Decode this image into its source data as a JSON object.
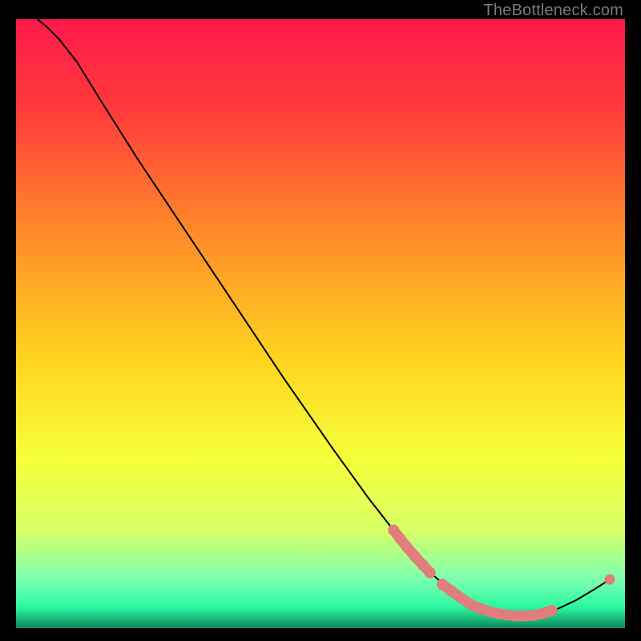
{
  "watermark": "TheBottleneck.com",
  "chart_data": {
    "type": "line",
    "title": "",
    "xlabel": "",
    "ylabel": "",
    "xlim": [
      0,
      100
    ],
    "ylim": [
      0,
      100
    ],
    "background_gradient": {
      "stops": [
        {
          "pos": 0.0,
          "color": "#ff1a4b"
        },
        {
          "pos": 0.15,
          "color": "#ff3b3b"
        },
        {
          "pos": 0.35,
          "color": "#ff8a2a"
        },
        {
          "pos": 0.55,
          "color": "#ffd21f"
        },
        {
          "pos": 0.72,
          "color": "#f6ff3a"
        },
        {
          "pos": 0.84,
          "color": "#d6ff66"
        },
        {
          "pos": 0.92,
          "color": "#7dffb0"
        },
        {
          "pos": 0.965,
          "color": "#2cf8a0"
        },
        {
          "pos": 1.0,
          "color": "#0c8a5a"
        }
      ]
    },
    "curve": [
      {
        "x": 3.5,
        "y": 100.0
      },
      {
        "x": 5.0,
        "y": 98.8
      },
      {
        "x": 7.0,
        "y": 96.8
      },
      {
        "x": 10.0,
        "y": 93.0
      },
      {
        "x": 14.0,
        "y": 86.5
      },
      {
        "x": 20.0,
        "y": 77.0
      },
      {
        "x": 28.0,
        "y": 65.0
      },
      {
        "x": 36.0,
        "y": 53.0
      },
      {
        "x": 44.0,
        "y": 41.0
      },
      {
        "x": 52.0,
        "y": 29.5
      },
      {
        "x": 58.0,
        "y": 21.2
      },
      {
        "x": 63.0,
        "y": 14.8
      },
      {
        "x": 67.5,
        "y": 9.6
      },
      {
        "x": 71.0,
        "y": 6.5
      },
      {
        "x": 74.0,
        "y": 4.3
      },
      {
        "x": 77.0,
        "y": 2.9
      },
      {
        "x": 80.0,
        "y": 2.2
      },
      {
        "x": 83.0,
        "y": 2.0
      },
      {
        "x": 86.0,
        "y": 2.3
      },
      {
        "x": 89.0,
        "y": 3.2
      },
      {
        "x": 92.0,
        "y": 4.6
      },
      {
        "x": 95.0,
        "y": 6.4
      },
      {
        "x": 97.5,
        "y": 8.0
      }
    ],
    "series": [
      {
        "name": "highlight-top-segment",
        "color": "#e07d7d",
        "style": "thick-rounded",
        "points": [
          {
            "x": 62.0,
            "y": 16.1
          },
          {
            "x": 63.0,
            "y": 14.8
          },
          {
            "x": 64.2,
            "y": 13.3
          },
          {
            "x": 65.5,
            "y": 11.8
          },
          {
            "x": 66.8,
            "y": 10.4
          },
          {
            "x": 68.0,
            "y": 9.1
          }
        ]
      },
      {
        "name": "highlight-bottom-segment",
        "color": "#e07d7d",
        "style": "thick-rounded",
        "points": [
          {
            "x": 70.0,
            "y": 7.2
          },
          {
            "x": 71.5,
            "y": 6.1
          },
          {
            "x": 73.0,
            "y": 5.0
          },
          {
            "x": 74.5,
            "y": 4.0
          },
          {
            "x": 76.0,
            "y": 3.3
          },
          {
            "x": 77.5,
            "y": 2.8
          },
          {
            "x": 79.0,
            "y": 2.4
          },
          {
            "x": 80.5,
            "y": 2.2
          },
          {
            "x": 82.0,
            "y": 2.0
          },
          {
            "x": 83.5,
            "y": 2.0
          },
          {
            "x": 85.0,
            "y": 2.1
          },
          {
            "x": 86.5,
            "y": 2.4
          },
          {
            "x": 88.0,
            "y": 2.9
          }
        ]
      },
      {
        "name": "end-point",
        "color": "#e07d7d",
        "style": "dot",
        "points": [
          {
            "x": 97.5,
            "y": 8.0
          }
        ]
      }
    ]
  }
}
